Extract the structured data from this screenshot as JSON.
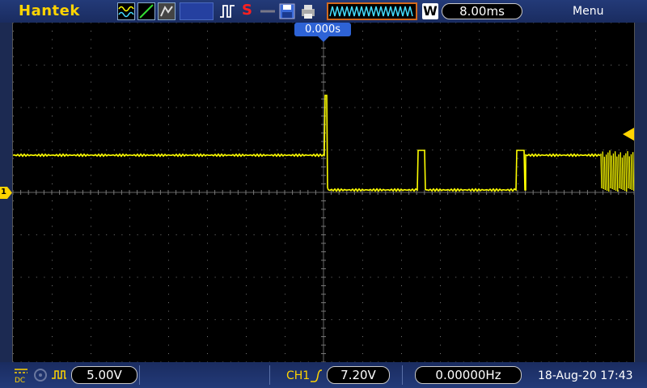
{
  "brand": "Hantek",
  "topbar": {
    "stop_glyph": "S",
    "waveform_mode": "WWWWWWWWW",
    "w_mark": "W",
    "timebase": "8.00ms",
    "menu": "Menu"
  },
  "screen": {
    "trigger_time": "0.000s",
    "channel_marker": "1"
  },
  "bottombar": {
    "coupling": "DC",
    "volts_div": "5.00V",
    "trigger_source": "CH1",
    "trigger_level": "7.20V",
    "frequency": "0.00000Hz",
    "datetime": "18-Aug-20 17:43"
  },
  "colors": {
    "trace": "#ffff00",
    "brand": "#ffd400",
    "background": "#1c2a52",
    "trigger_blue": "#2e63d6"
  }
}
